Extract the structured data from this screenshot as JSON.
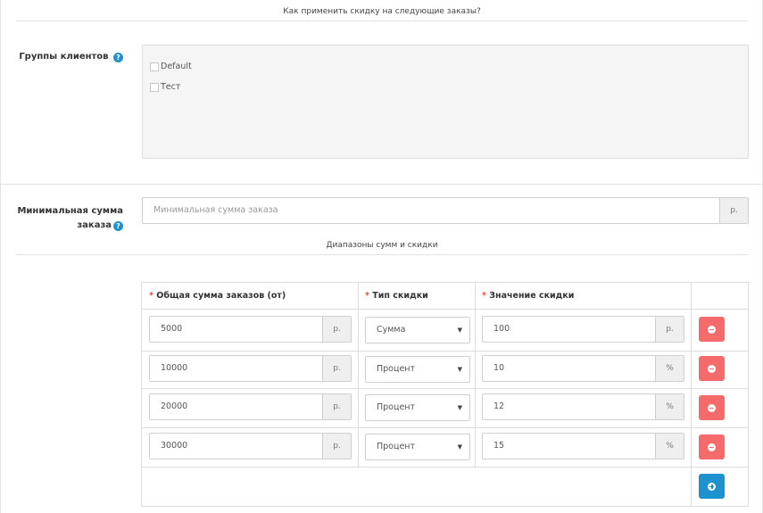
{
  "legend_apply": "Как применить скидку на следующие заказы?",
  "legend_ranges": "Диапазоны сумм и скидки",
  "customer_groups": {
    "label": "Группы клиентов",
    "options": [
      "Default",
      "Тест"
    ]
  },
  "min_sum": {
    "label_line1": "Минимальная сумма",
    "label_line2": "заказа",
    "placeholder": "Минимальная сумма заказа",
    "addon": "р."
  },
  "table": {
    "headers": [
      "Общая сумма заказов (от)",
      "Тип скидки",
      "Значение скидки"
    ],
    "required_mark": "*",
    "rows": [
      {
        "total": "5000",
        "total_addon": "р.",
        "type": "Сумма",
        "value": "100",
        "value_addon": "р."
      },
      {
        "total": "10000",
        "total_addon": "р.",
        "type": "Процент",
        "value": "10",
        "value_addon": "%"
      },
      {
        "total": "20000",
        "total_addon": "р.",
        "type": "Процент",
        "value": "12",
        "value_addon": "%"
      },
      {
        "total": "30000",
        "total_addon": "р.",
        "type": "Процент",
        "value": "15",
        "value_addon": "%"
      }
    ]
  },
  "icons": {
    "help": "question-circle-icon",
    "remove": "minus-circle-icon",
    "add": "plus-circle-icon"
  },
  "colors": {
    "danger": "#f56b6b",
    "primary": "#1e91cf",
    "required": "#e3503e"
  }
}
